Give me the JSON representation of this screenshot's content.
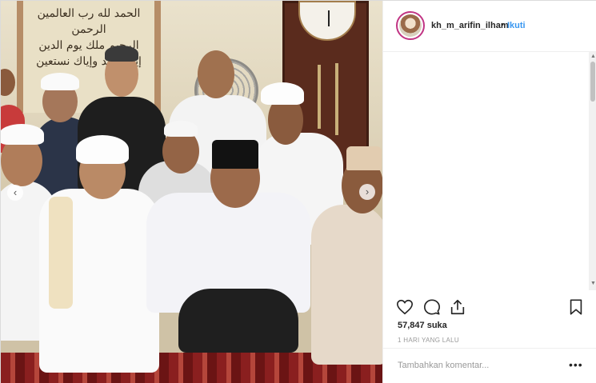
{
  "photo": {
    "calligraphy": [
      "الحمد لله رب العالمين الرحمن",
      "الرحيم ملك يوم الدين",
      "إياك نعبد وإياك نستعين"
    ],
    "prev_icon": "chevron-left-icon",
    "next_icon": "chevron-right-icon"
  },
  "header": {
    "username": "kh_m_arifin_ilham",
    "separator": "•",
    "follow_label": "Ikuti"
  },
  "actions": {
    "like_icon": "heart-icon",
    "comment_icon": "comment-icon",
    "share_icon": "share-icon",
    "save_icon": "bookmark-icon"
  },
  "stats": {
    "likes": "57,847 suka",
    "timestamp": "1 HARI YANG LALU"
  },
  "comment_box": {
    "placeholder": "Tambahkan komentar...",
    "more_label": "•••"
  },
  "colors": {
    "link": "#3897f0",
    "text": "#262626",
    "muted": "#999999",
    "story_ring": "#c13584"
  }
}
